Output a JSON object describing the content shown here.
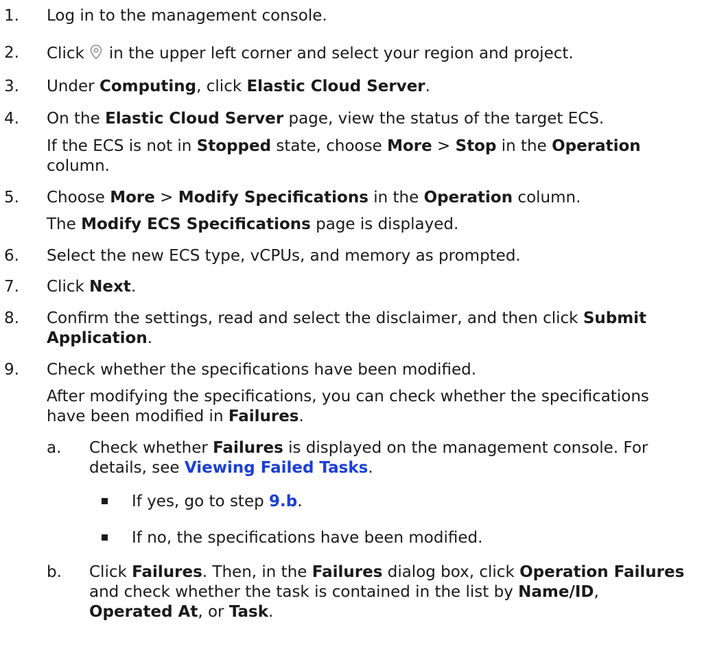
{
  "steps": {
    "s1": {
      "num": "1.",
      "t1": "Log in to the management console."
    },
    "s2": {
      "num": "2.",
      "t1": "Click",
      "t2": "in the upper left corner and select your region and project.",
      "icon": "location-pin-icon"
    },
    "s3": {
      "num": "3.",
      "t1": "Under ",
      "b1": "Computing",
      "t2": ", click ",
      "b2": "Elastic Cloud Server",
      "t3": "."
    },
    "s4": {
      "num": "4.",
      "t1": "On the ",
      "b1": "Elastic Cloud Server",
      "t2": " page, view the status of the target ECS.",
      "p1": "If the ECS is not in ",
      "p1b1": "Stopped",
      "p1t2": " state, choose ",
      "p1b2": "More",
      "p1t3": " > ",
      "p1b3": "Stop",
      "p1t4": " in the ",
      "p1b4": "Operation",
      "p2": "column."
    },
    "s5": {
      "num": "5.",
      "t1": "Choose ",
      "b1": "More",
      "t2": " > ",
      "b2": "Modify Specifications",
      "t3": " in the ",
      "b3": "Operation",
      "t4": " column.",
      "p1": "The ",
      "p1b1": "Modify ECS Specifications",
      "p1t2": " page is displayed."
    },
    "s6": {
      "num": "6.",
      "t1": "Select the new ECS type, vCPUs, and memory as prompted."
    },
    "s7": {
      "num": "7.",
      "t1": "Click ",
      "b1": "Next",
      "t2": "."
    },
    "s8": {
      "num": "8.",
      "t1": "Confirm the settings, read and select the disclaimer, and then click ",
      "b1": "Submit",
      "l2b": "Application",
      "l2t": "."
    },
    "s9": {
      "num": "9.",
      "t1": "Check whether the specifications have been modified.",
      "p1": "After modifying the specifications, you can check whether the specifications",
      "p2": "have been modified in ",
      "p2b": "Failures",
      "p2t": "."
    },
    "sa": {
      "num": "a.",
      "t1": "Check whether ",
      "b1": "Failures",
      "t2": " is displayed on the management console. For",
      "l2": "details, see ",
      "link": "Viewing Failed Tasks",
      "l2t": "."
    },
    "bul1": {
      "t1": "If yes, go to step ",
      "link": "9.b",
      "t2": "."
    },
    "bul2": {
      "t1": "If no, the specifications have been modified."
    },
    "sb": {
      "num": "b.",
      "t1": "Click ",
      "b1": "Failures",
      "t2": ". Then, in the ",
      "b2": "Failures",
      "t3": " dialog box, click ",
      "b3": "Operation Failures",
      "l2": "and check whether the task is contained in the list by ",
      "l2b": "Name/ID",
      "l2t": ",",
      "l3b": "Operated At",
      "l3t": ", or ",
      "l3b2": "Task",
      "l3t2": "."
    }
  }
}
